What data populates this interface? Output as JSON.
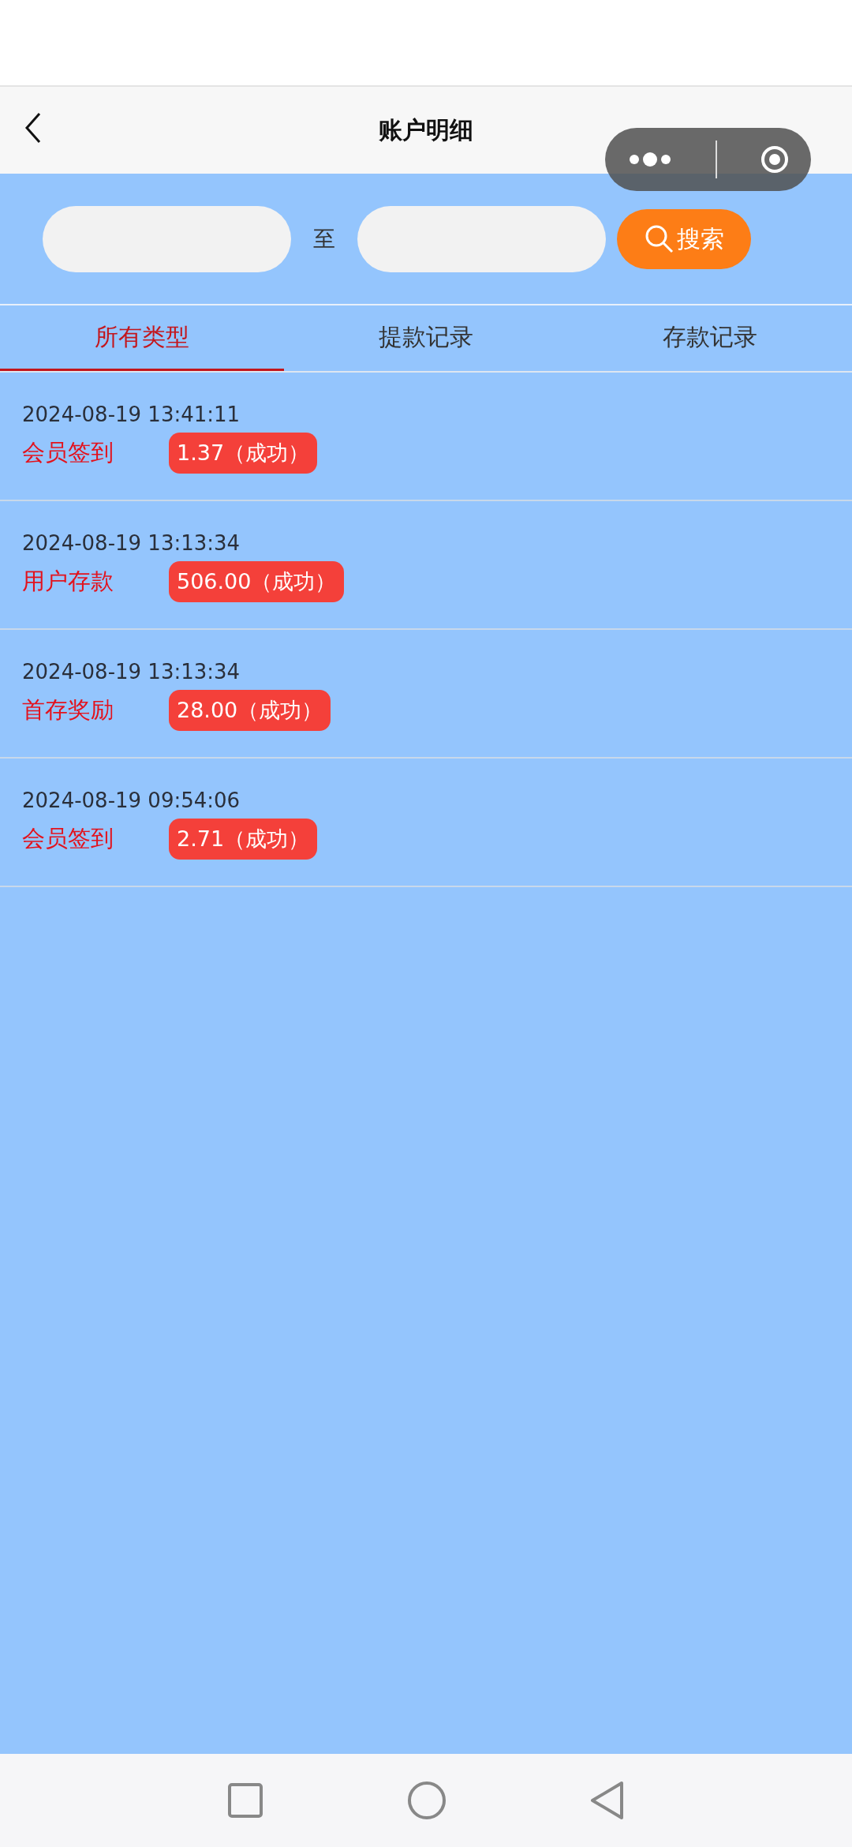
{
  "header": {
    "title": "账户明细"
  },
  "search": {
    "separator": "至",
    "button": "搜索"
  },
  "tabs": [
    {
      "label": "所有类型",
      "selected": true
    },
    {
      "label": "提款记录",
      "selected": false
    },
    {
      "label": "存款记录",
      "selected": false
    }
  ],
  "records": [
    {
      "time": "2024-08-19 13:41:11",
      "type": "会员签到",
      "amount": "1.37（成功）"
    },
    {
      "time": "2024-08-19 13:13:34",
      "type": "用户存款",
      "amount": "506.00（成功）"
    },
    {
      "time": "2024-08-19 13:13:34",
      "type": "首存奖励",
      "amount": "28.00（成功）"
    },
    {
      "time": "2024-08-19 09:54:06",
      "type": "会员签到",
      "amount": "2.71（成功）"
    }
  ]
}
